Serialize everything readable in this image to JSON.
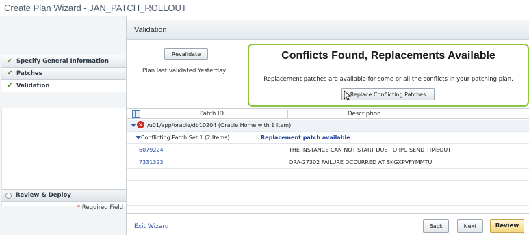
{
  "window": {
    "title": "Create Plan Wizard - JAN_PATCH_ROLLOUT"
  },
  "sidebar": {
    "steps": [
      {
        "label": "Specify General Information",
        "status": "complete"
      },
      {
        "label": "Patches",
        "status": "complete"
      },
      {
        "label": "Validation",
        "status": "current"
      }
    ],
    "review_step": "Review & Deploy",
    "required_field": "Required Field",
    "required_marker": "*"
  },
  "main": {
    "section_title": "Validation",
    "revalidate_label": "Revalidate",
    "last_validated": "Plan last validated Yesterday",
    "conflicts": {
      "headline": "Conflicts Found, Replacements Available",
      "message": "Replacement patches are available for some or all the conflicts in your patching plan.",
      "button_label": "Replace Conflicting Patches"
    },
    "table": {
      "columns": {
        "patch_id": "Patch ID",
        "description": "Description"
      },
      "oracle_home": "/u01/app/oracle/db10204 (Oracle Home with 1 Item)",
      "conflict_set": "Conflicting Patch Set 1 (2 Items)",
      "replacement_note": "Replacement patch available",
      "patches": [
        {
          "id": "6079224",
          "description": "THE INSTANCE CAN NOT START DUE TO IPC SEND TIMEOUT"
        },
        {
          "id": "7331323",
          "description": "ORA-27302 FAILURE OCCURRED AT SKGXPVFYMMTU"
        }
      ]
    }
  },
  "footer": {
    "exit_label": "Exit Wizard",
    "back_label": "Back",
    "next_label": "Next",
    "review_label": "Review"
  },
  "colors": {
    "accent_green": "#8cc63f",
    "link_blue": "#2a4fa0",
    "error_red": "#c8302a",
    "review_button": "#f4d57a"
  }
}
